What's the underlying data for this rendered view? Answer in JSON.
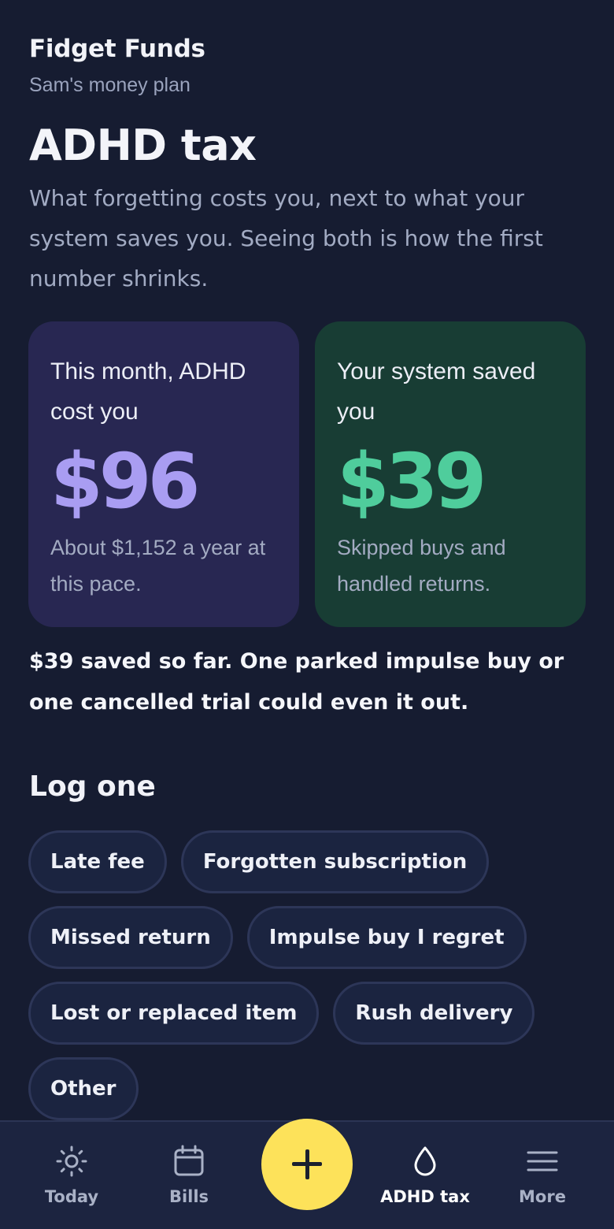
{
  "app": {
    "title": "Fidget Funds",
    "subtitle": "Sam's money plan"
  },
  "page": {
    "title": "ADHD tax",
    "description": "What forgetting costs you, next to what your system saves you. Seeing both is how the first number shrinks."
  },
  "cards": {
    "cost": {
      "label": "This month, ADHD cost you",
      "amount": "$96",
      "note": "About $1,152 a year at this pace.",
      "accent_color": "#a99df2",
      "background": "#282752"
    },
    "saved": {
      "label": "Your system saved you",
      "amount": "$39",
      "note": "Skipped buys and handled returns.",
      "accent_color": "#4fcd9c",
      "background": "#183d34"
    }
  },
  "summary": "$39 saved so far. One parked impulse buy or one cancelled trial could even it out.",
  "log": {
    "title": "Log one",
    "options": [
      "Late fee",
      "Forgotten subscription",
      "Missed return",
      "Impulse buy I regret",
      "Lost or replaced item",
      "Rush delivery",
      "Other"
    ]
  },
  "nav": {
    "items": [
      {
        "label": "Today",
        "icon": "sun-icon"
      },
      {
        "label": "Bills",
        "icon": "calendar-icon"
      },
      {
        "label": "ADHD tax",
        "icon": "drop-icon",
        "active": true
      },
      {
        "label": "More",
        "icon": "menu-icon"
      }
    ],
    "add_button_icon": "plus-icon",
    "add_button_color": "#fde25a"
  }
}
